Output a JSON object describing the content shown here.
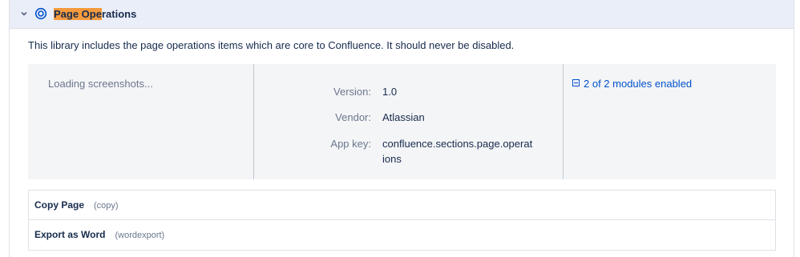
{
  "plugin": {
    "name_highlight": "Page Ope",
    "name_rest": "rations",
    "description": "This library includes the page operations items which are core to Confluence. It should never be disabled.",
    "screenshots_text": "Loading screenshots...",
    "version_label": "Version:",
    "version_value": "1.0",
    "vendor_label": "Vendor:",
    "vendor_value": "Atlassian",
    "appkey_label": "App key:",
    "appkey_value_line1": "confluence.sections.page.operat",
    "appkey_value_line2": "ions",
    "modules_link": "2 of 2 modules enabled"
  },
  "modules": [
    {
      "name": "Copy Page",
      "key": "(copy)"
    },
    {
      "name": "Export as Word",
      "key": "(wordexport)"
    }
  ],
  "colors": {
    "header_bg": "#eaeef9",
    "highlight": "#f59a3d",
    "link": "#0052cc",
    "details_bg": "#f4f5f7"
  },
  "icons": {
    "chevron": "chevron-down-icon",
    "plugin": "plugin-icon",
    "modules": "collapse-icon"
  }
}
